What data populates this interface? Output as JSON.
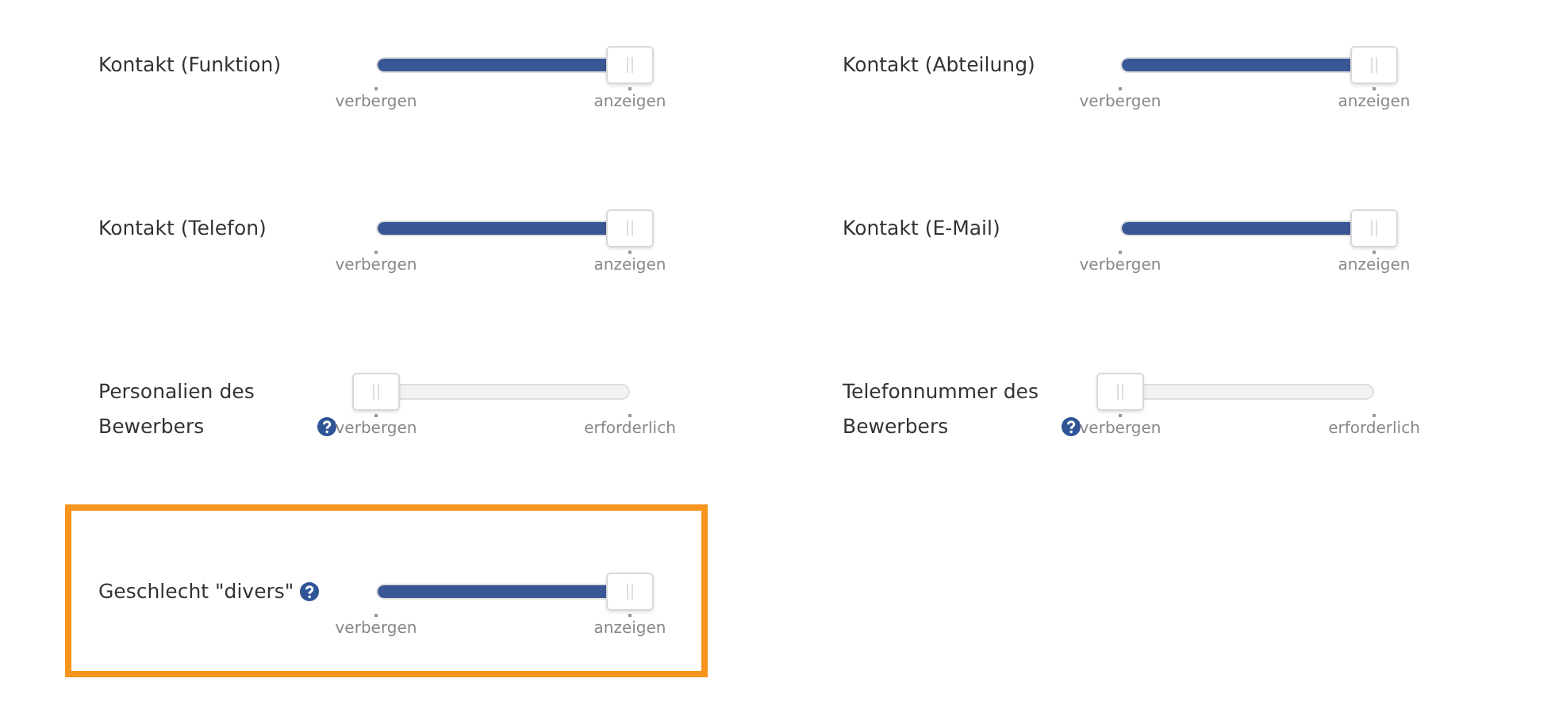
{
  "settings": [
    {
      "label": "Kontakt (Funktion)",
      "help": false,
      "level": 1,
      "min_label": "verbergen",
      "max_label": "anzeigen",
      "highlighted": false
    },
    {
      "label": "Kontakt (Abteilung)",
      "help": false,
      "level": 1,
      "min_label": "verbergen",
      "max_label": "anzeigen",
      "highlighted": false
    },
    {
      "label": "Kontakt (Telefon)",
      "help": false,
      "level": 1,
      "min_label": "verbergen",
      "max_label": "anzeigen",
      "highlighted": false
    },
    {
      "label": "Kontakt (E-Mail)",
      "help": false,
      "level": 1,
      "min_label": "verbergen",
      "max_label": "anzeigen",
      "highlighted": false
    },
    {
      "label": "Personalien des Bewerbers",
      "help": true,
      "level": 0,
      "min_label": "verbergen",
      "max_label": "erforderlich",
      "highlighted": false
    },
    {
      "label": "Telefonnummer des Bewerbers",
      "help": true,
      "level": 0,
      "min_label": "verbergen",
      "max_label": "erforderlich",
      "highlighted": false
    },
    {
      "label": "Geschlecht \"divers\"",
      "help": true,
      "level": 1,
      "min_label": "verbergen",
      "max_label": "anzeigen",
      "highlighted": true
    }
  ]
}
